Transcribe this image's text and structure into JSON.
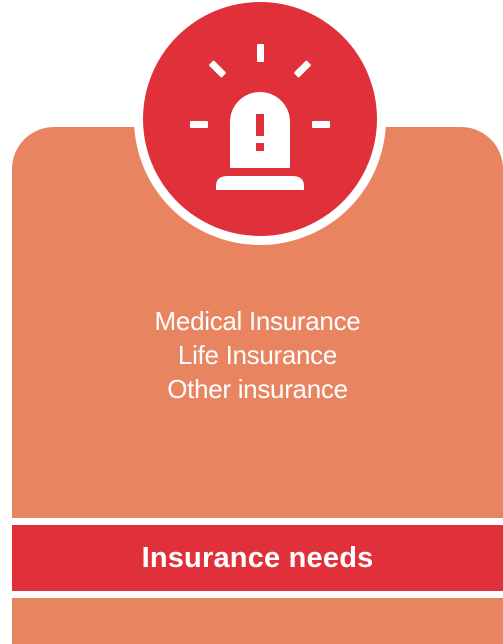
{
  "card": {
    "icon": "alarm-siren-icon",
    "lines": [
      "Medical Insurance",
      "Life Insurance",
      "Other insurance"
    ],
    "title": "Insurance needs"
  },
  "colors": {
    "accent_red": "#e0313b",
    "card_orange": "#e98461",
    "text": "#ffffff"
  }
}
